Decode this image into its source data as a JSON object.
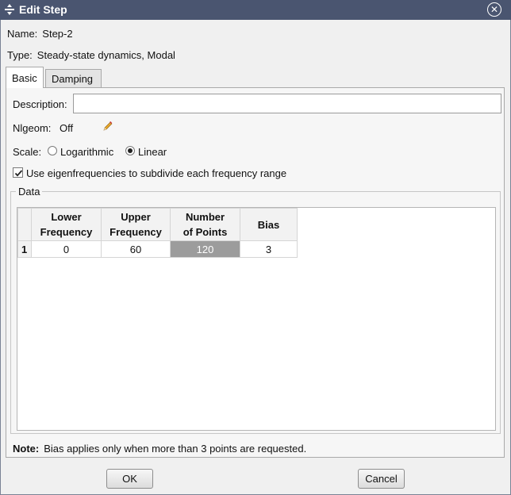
{
  "window": {
    "title": "Edit Step",
    "close_glyph": "✕"
  },
  "info": {
    "name_label": "Name:",
    "name_value": "Step-2",
    "type_label": "Type:",
    "type_value": "Steady-state dynamics, Modal"
  },
  "tabs": [
    {
      "label": "Basic",
      "active": true
    },
    {
      "label": "Damping",
      "active": false
    }
  ],
  "basic": {
    "description_label": "Description:",
    "description_value": "",
    "nlgeom_label": "Nlgeom:",
    "nlgeom_value": "Off",
    "scale_label": "Scale:",
    "scale_options": [
      {
        "label": "Logarithmic",
        "checked": false
      },
      {
        "label": "Linear",
        "checked": true
      }
    ],
    "eigen_checkbox_label": "Use eigenfrequencies to subdivide each frequency range",
    "eigen_checked": true,
    "data_group_label": "Data",
    "table": {
      "headers": [
        [
          "Lower",
          "Frequency"
        ],
        [
          "Upper",
          "Frequency"
        ],
        [
          "Number",
          "of Points"
        ],
        [
          "Bias"
        ]
      ],
      "rows": [
        {
          "index": "1",
          "cells": [
            "0",
            "60",
            "120",
            "3"
          ],
          "selected_col": 2
        }
      ]
    }
  },
  "note": {
    "label": "Note:",
    "text": "Bias applies only when more than 3 points are requested."
  },
  "buttons": {
    "ok": "OK",
    "cancel": "Cancel"
  },
  "colors": {
    "titlebar": "#4a5570",
    "selected_cell": "#9c9c9c"
  },
  "icons": {
    "app": "move-arrows-icon",
    "close": "close-circle-icon",
    "edit": "pencil-icon",
    "check": "checkmark-icon"
  }
}
